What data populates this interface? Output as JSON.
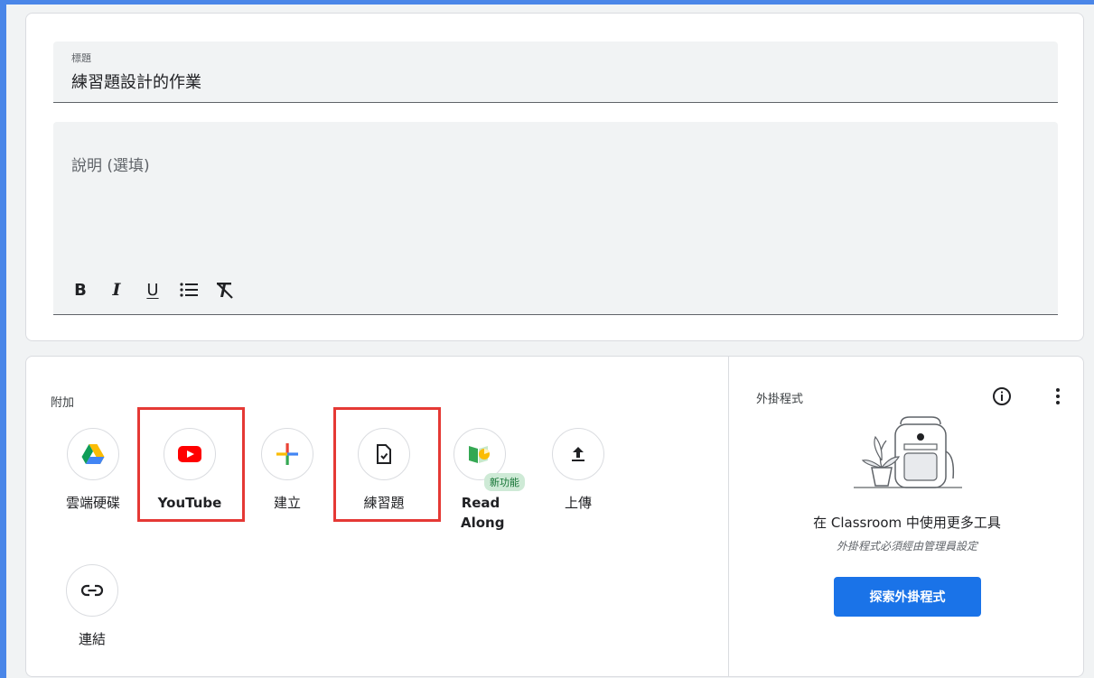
{
  "form": {
    "title_label": "標題",
    "title_value": "練習題設計的作業",
    "description_placeholder": "說明 (選填)",
    "format_buttons": {
      "bold": "B",
      "italic": "I",
      "underline": "U"
    }
  },
  "attach": {
    "title": "附加",
    "items": [
      {
        "label": "雲端硬碟",
        "icon": "google-drive-icon"
      },
      {
        "label": "YouTube",
        "icon": "youtube-icon"
      },
      {
        "label": "建立",
        "icon": "plus-icon"
      },
      {
        "label": "練習題",
        "icon": "practice-set-icon"
      },
      {
        "label": "Read Along",
        "icon": "read-along-icon",
        "badge": "新功能"
      },
      {
        "label": "上傳",
        "icon": "upload-icon"
      },
      {
        "label": "連結",
        "icon": "link-icon"
      }
    ]
  },
  "addons": {
    "title": "外掛程式",
    "heading": "在 Classroom 中使用更多工具",
    "subheading": "外掛程式必須經由管理員設定",
    "button": "探索外掛程式"
  },
  "colors": {
    "accent": "#1a73e8",
    "highlight": "#e53935",
    "badge_bg": "#ceead6",
    "badge_text": "#137333"
  }
}
